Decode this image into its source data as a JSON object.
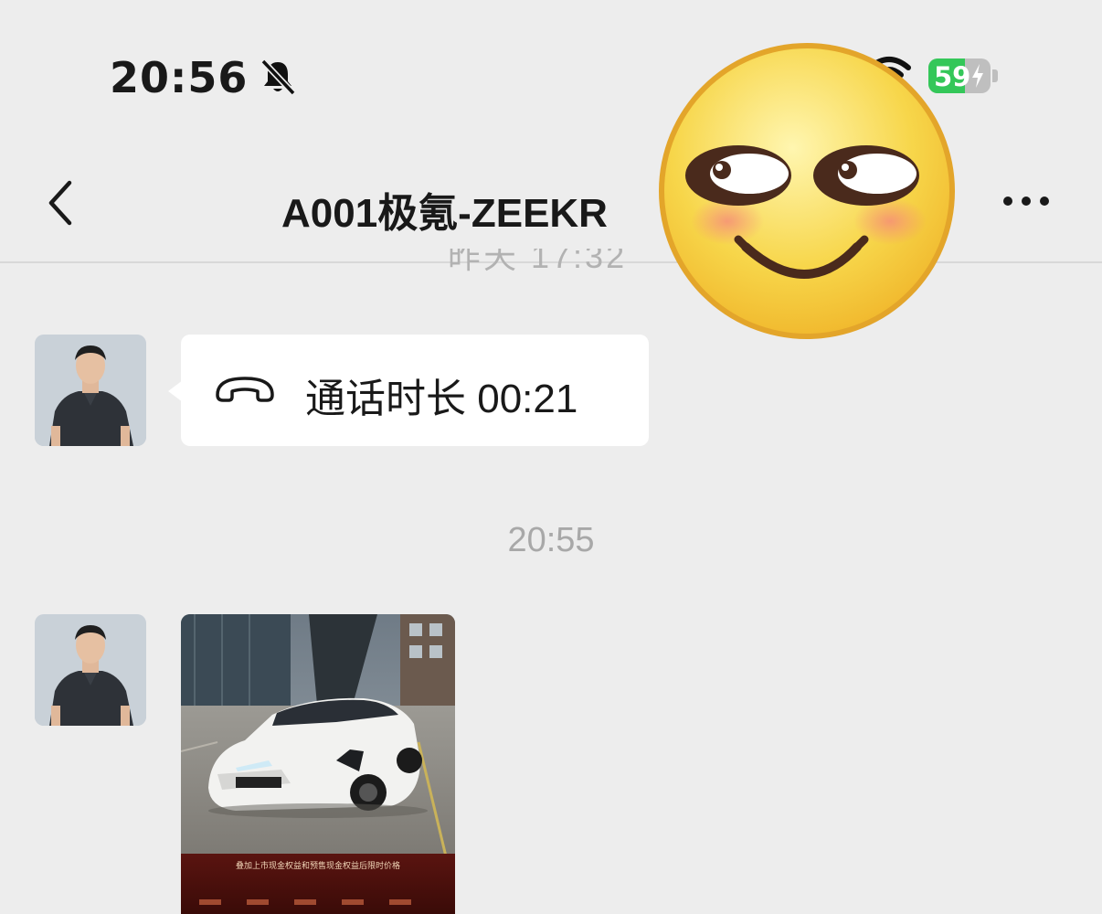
{
  "status_bar": {
    "time": "20:56",
    "battery_level": "59",
    "battery_percent": 59,
    "charging": true
  },
  "nav": {
    "title": "A001极氪-ZEEKR"
  },
  "messages": {
    "partial_timestamp": "昨天 17:32",
    "call": {
      "label": "通话时长 00:21"
    },
    "timestamp": "20:55",
    "photo_caption": "叠加上市现金权益和预售现金权益后限时价格"
  },
  "icons": {
    "back": "chevron-left-icon",
    "more": "more-dots-icon",
    "mute": "bell-slash-icon",
    "wifi": "wifi-icon",
    "call": "phone-hangup-icon",
    "sticker": "smiling-emoji-sticker"
  },
  "colors": {
    "background": "#ededed",
    "bubble": "#ffffff",
    "battery_green": "#34c759",
    "timestamp_gray": "#a8a8a8"
  }
}
